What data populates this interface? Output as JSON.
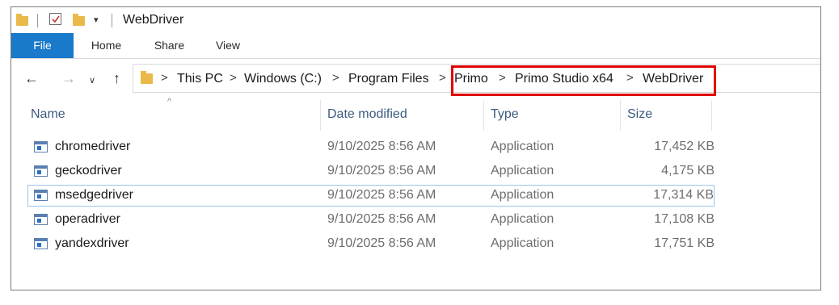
{
  "window": {
    "title": "WebDriver"
  },
  "ribbon": {
    "tabs": {
      "file": "File",
      "home": "Home",
      "share": "Share",
      "view": "View"
    }
  },
  "nav": {
    "back_icon": "arrow-left-icon",
    "forward_icon": "arrow-right-icon",
    "recent_icon": "chevron-down-icon",
    "up_icon": "arrow-up-icon"
  },
  "address": {
    "crumbs": [
      "This PC",
      "Windows (C:)",
      "Program Files",
      "Primo",
      "Primo Studio x64",
      "WebDriver"
    ],
    "separator": ">"
  },
  "columns": {
    "name": "Name",
    "date": "Date modified",
    "type": "Type",
    "size": "Size",
    "sort_indicator": "^"
  },
  "files": [
    {
      "name": "chromedriver",
      "date": "9/10/2025 8:56 AM",
      "type": "Application",
      "size": "17,452 KB"
    },
    {
      "name": "geckodriver",
      "date": "9/10/2025 8:56 AM",
      "type": "Application",
      "size": "4,175 KB"
    },
    {
      "name": "msedgedriver",
      "date": "9/10/2025 8:56 AM",
      "type": "Application",
      "size": "17,314 KB"
    },
    {
      "name": "operadriver",
      "date": "9/10/2025 8:56 AM",
      "type": "Application",
      "size": "17,108 KB"
    },
    {
      "name": "yandexdriver",
      "date": "9/10/2025 8:56 AM",
      "type": "Application",
      "size": "17,751 KB"
    }
  ],
  "colors": {
    "accent": "#1979ca",
    "highlight": "#e10000",
    "folder": "#e9b949"
  }
}
